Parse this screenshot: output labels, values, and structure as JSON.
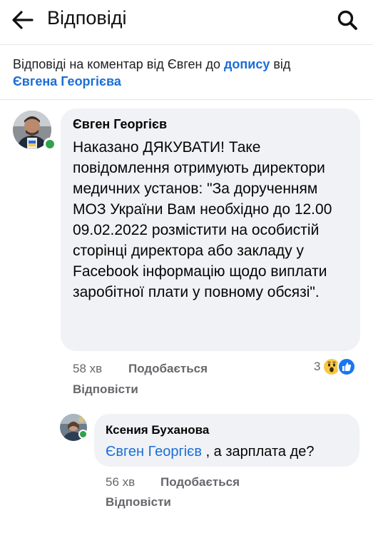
{
  "header": {
    "title": "Відповіді"
  },
  "context": {
    "prefix": "Відповіді на коментар від Євген до ",
    "post_link": "допису",
    "middle": " від",
    "author_link": "Євгена Георгієва"
  },
  "comment": {
    "author": "Євген Георгієв",
    "text": "Наказано ДЯКУВАТИ! Таке повідомлення отримують директори медичних установ: \"За дорученням МОЗ України Вам необхідно до 12.00 09.02.2022 розмістити на особистій сторінці директора або закладу у Facebook інформацію щодо виплати заробітної плати у повному обсязі\".",
    "time": "58 хв",
    "like_label": "Подобається",
    "reply_label": "Відповісти",
    "reaction_count": "3",
    "reactions": [
      "wow-icon",
      "like-icon"
    ]
  },
  "reply": {
    "author": "Ксения Буханова",
    "mention": "Євген Георгієв",
    "text": " , а зарплата де?",
    "time": "56 хв",
    "like_label": "Подобається",
    "reply_label": "Відповісти"
  },
  "colors": {
    "accent": "#1b6ed6",
    "bubble": "#f0f2f5",
    "meta": "#65676b",
    "online": "#31a24c",
    "like": "#1877f2",
    "wow": "#f7c843"
  }
}
